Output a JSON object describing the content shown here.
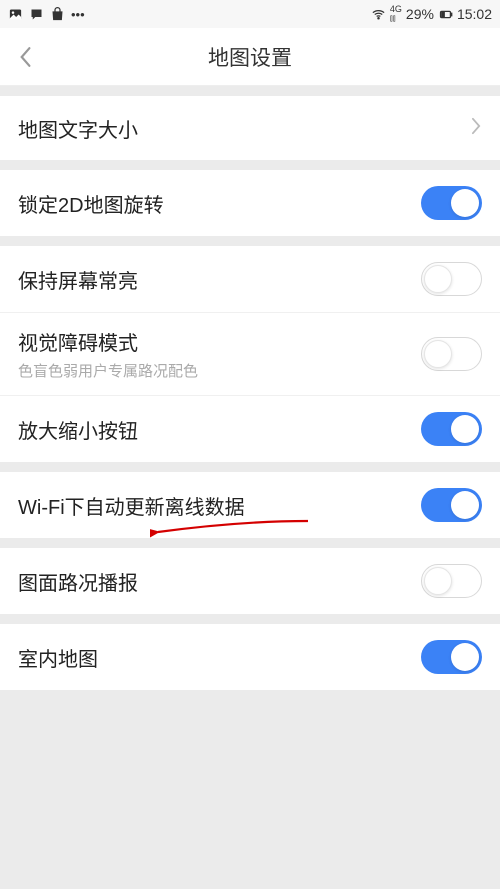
{
  "status": {
    "battery": "29%",
    "time": "15:02"
  },
  "header": {
    "title": "地图设置"
  },
  "rows": {
    "textSize": {
      "label": "地图文字大小"
    },
    "lock2d": {
      "label": "锁定2D地图旋转",
      "on": true
    },
    "keepScreen": {
      "label": "保持屏幕常亮",
      "on": false
    },
    "visualImpair": {
      "label": "视觉障碍模式",
      "sub": "色盲色弱用户专属路况配色",
      "on": false
    },
    "zoomButtons": {
      "label": "放大缩小按钮",
      "on": true
    },
    "wifiOffline": {
      "label": "Wi-Fi下自动更新离线数据",
      "on": true
    },
    "trafficVoice": {
      "label": "图面路况播报",
      "on": false
    },
    "indoorMap": {
      "label": "室内地图",
      "on": true
    }
  }
}
